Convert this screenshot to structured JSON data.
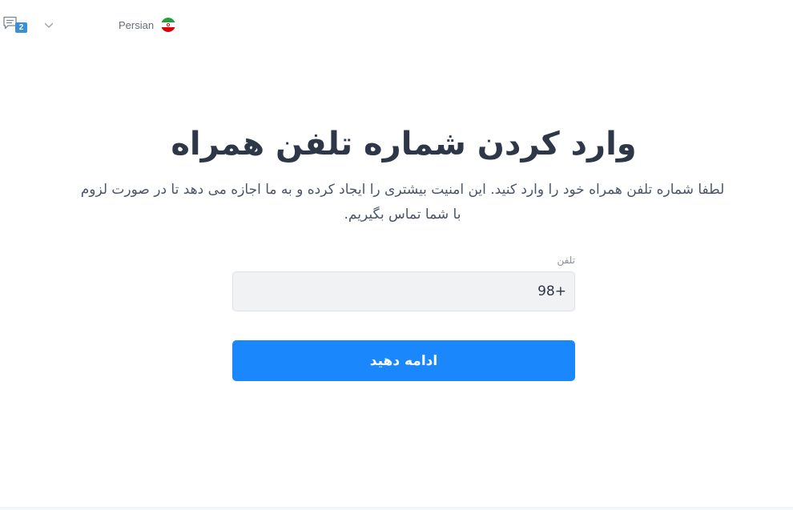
{
  "header": {
    "chat": {
      "icon": "chat-icon",
      "badge_count": "2"
    },
    "dropdown": {
      "icon": "chevron-down-icon"
    },
    "language": {
      "label": "Persian",
      "flag_icon": "iran-flag-icon"
    }
  },
  "main": {
    "title": "وارد کردن شماره تلفن همراه",
    "description": "لطفا شماره تلفن همراه خود را وارد کنید. این امنیت بیشتری را ایجاد کرده و به ما اجازه می دهد تا در صورت لزوم با شما تماس بگیریم.",
    "phone_field": {
      "label": "تلفن",
      "value": "+98"
    },
    "submit_label": "ادامه دهید"
  },
  "colors": {
    "primary_button": "#1a87fd",
    "badge": "#3b8fd6",
    "title_text": "#2d3748",
    "input_background": "#f1f2f4"
  }
}
